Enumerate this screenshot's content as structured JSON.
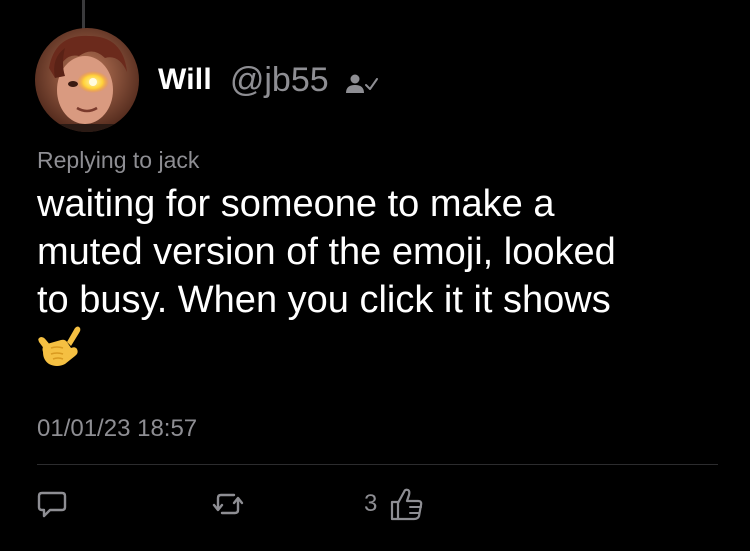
{
  "post": {
    "author": {
      "display_name": "Will",
      "handle": "@jb55",
      "follows_icon": "person-check-icon"
    },
    "reply_context": "Replying to jack",
    "text": "waiting for someone to make a\nmuted version of the emoji, looked\nto busy. When you click it it shows",
    "emoji": "call-me-hand-emoji",
    "timestamp": "01/01/23 18:57"
  },
  "actions": {
    "reply_icon": "reply-bubble-icon",
    "repost_icon": "repost-icon",
    "like_icon": "thumbs-up-icon",
    "like_count": "3"
  },
  "colors": {
    "background": "#000000",
    "primary_text": "#ffffff",
    "secondary_text": "#8e8e93",
    "divider": "#2c2c2e"
  }
}
